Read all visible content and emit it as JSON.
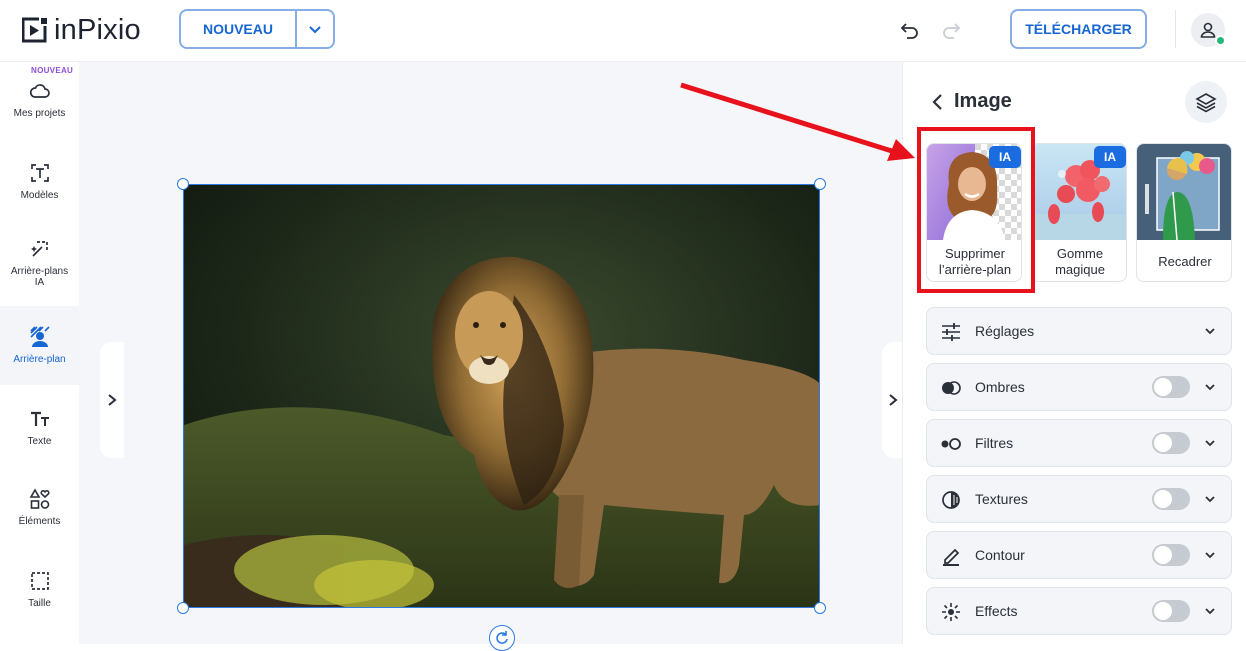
{
  "header": {
    "logo_text": "inPixio",
    "new_button_label": "NOUVEAU",
    "download_button_label": "TÉLÉCHARGER",
    "icons": [
      "logo-icon",
      "chevron-down-icon",
      "undo-icon",
      "redo-icon",
      "user-icon"
    ]
  },
  "sidebar": {
    "new_tag": "NOUVEAU",
    "items": [
      {
        "label": "Mes projets",
        "icon": "cloud-icon"
      },
      {
        "label": "Modèles",
        "icon": "templates-icon"
      },
      {
        "label": "Arrière-plans IA",
        "icon": "ai-background-icon"
      },
      {
        "label": "Arrière-plan",
        "icon": "background-icon",
        "active": true
      },
      {
        "label": "Texte",
        "icon": "text-icon"
      },
      {
        "label": "Éléments",
        "icon": "elements-icon"
      },
      {
        "label": "Taille",
        "icon": "size-icon"
      }
    ]
  },
  "panel": {
    "title": "Image",
    "tools": [
      {
        "label": "Supprimer l’arrière-plan",
        "badge": "IA"
      },
      {
        "label": "Gomme magique",
        "badge": "IA"
      },
      {
        "label": "Recadrer",
        "badge": ""
      }
    ],
    "sections": [
      {
        "label": "Réglages",
        "toggle": false
      },
      {
        "label": "Ombres",
        "toggle": true
      },
      {
        "label": "Filtres",
        "toggle": true
      },
      {
        "label": "Textures",
        "toggle": true
      },
      {
        "label": "Contour",
        "toggle": true
      },
      {
        "label": "Effects",
        "toggle": true
      }
    ]
  },
  "colors": {
    "accent": "#1666d3",
    "selection": "#2a7ae2",
    "annotation": "#e8121c",
    "ai_badge": "#1b6ce0"
  }
}
